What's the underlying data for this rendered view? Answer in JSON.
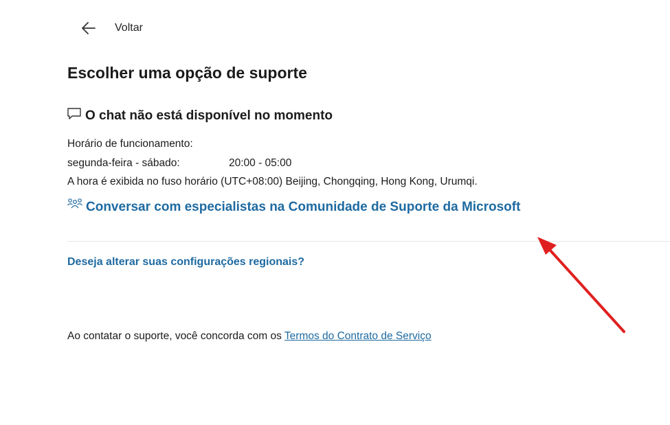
{
  "back": {
    "label": "Voltar",
    "icon": "arrow-left-icon"
  },
  "page_title": "Escolher uma opção de suporte",
  "chat": {
    "icon": "chat-bubble-icon",
    "heading": "O chat não está disponível no momento",
    "hours_label": "Horário de funcionamento:",
    "days": "segunda-feira - sábado:",
    "time": "20:00 - 05:00",
    "timezone_note": "A hora é exibida no fuso horário (UTC+08:00) Beijing, Chongqing, Hong Kong, Urumqi."
  },
  "community": {
    "icon": "people-community-icon",
    "label": "Conversar com especialistas na Comunidade de Suporte da Microsoft"
  },
  "region_link": "Deseja alterar suas configurações regionais?",
  "terms": {
    "prefix": "Ao contatar o suporte, você concorda com os ",
    "link": "Termos do Contrato de Serviço"
  },
  "colors": {
    "link": "#1e6aa1",
    "text": "#1b1b1b",
    "annotation_arrow": "#e02020"
  }
}
